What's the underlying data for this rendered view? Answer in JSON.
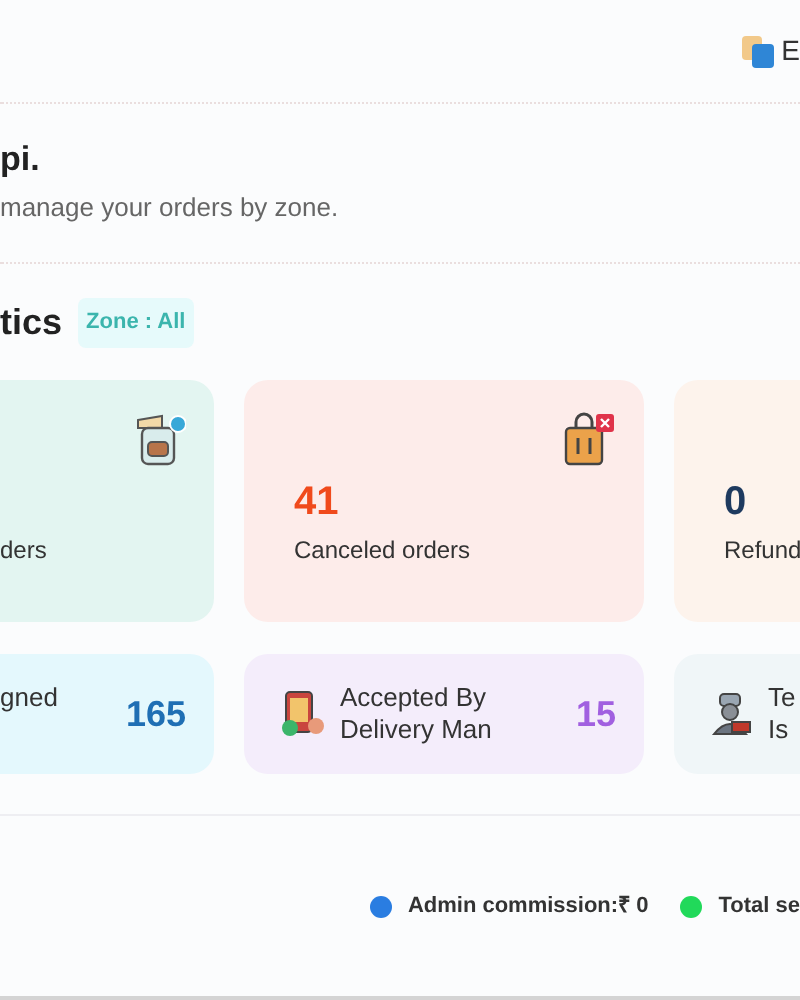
{
  "header": {
    "language": "E"
  },
  "greeting": {
    "title": "pi.",
    "subtitle": "manage your orders by zone."
  },
  "statistics": {
    "title": "tics",
    "zone_badge": "Zone : All"
  },
  "order_cards": [
    {
      "kind": "cut-left",
      "label": "ders"
    },
    {
      "kind": "full",
      "value": "41",
      "label": "Canceled orders",
      "color": "#f04a1c"
    },
    {
      "kind": "cut-right",
      "value": "0",
      "label": "Refund",
      "color": "#1e3a5f"
    }
  ],
  "status_cards": [
    {
      "kind": "cut-left",
      "lines": [
        "gned"
      ],
      "value": "165",
      "color": "#1f6fb4"
    },
    {
      "kind": "full",
      "lines": [
        "Accepted By",
        "Delivery Man"
      ],
      "value": "15",
      "color": "#a160e0"
    },
    {
      "kind": "cut-right",
      "lines": [
        "Te",
        "Is"
      ]
    }
  ],
  "legend": [
    {
      "label": "Admin commission:₹ 0",
      "color": "#2a7de1"
    },
    {
      "label": "Total se",
      "color": "#21d95a"
    }
  ]
}
